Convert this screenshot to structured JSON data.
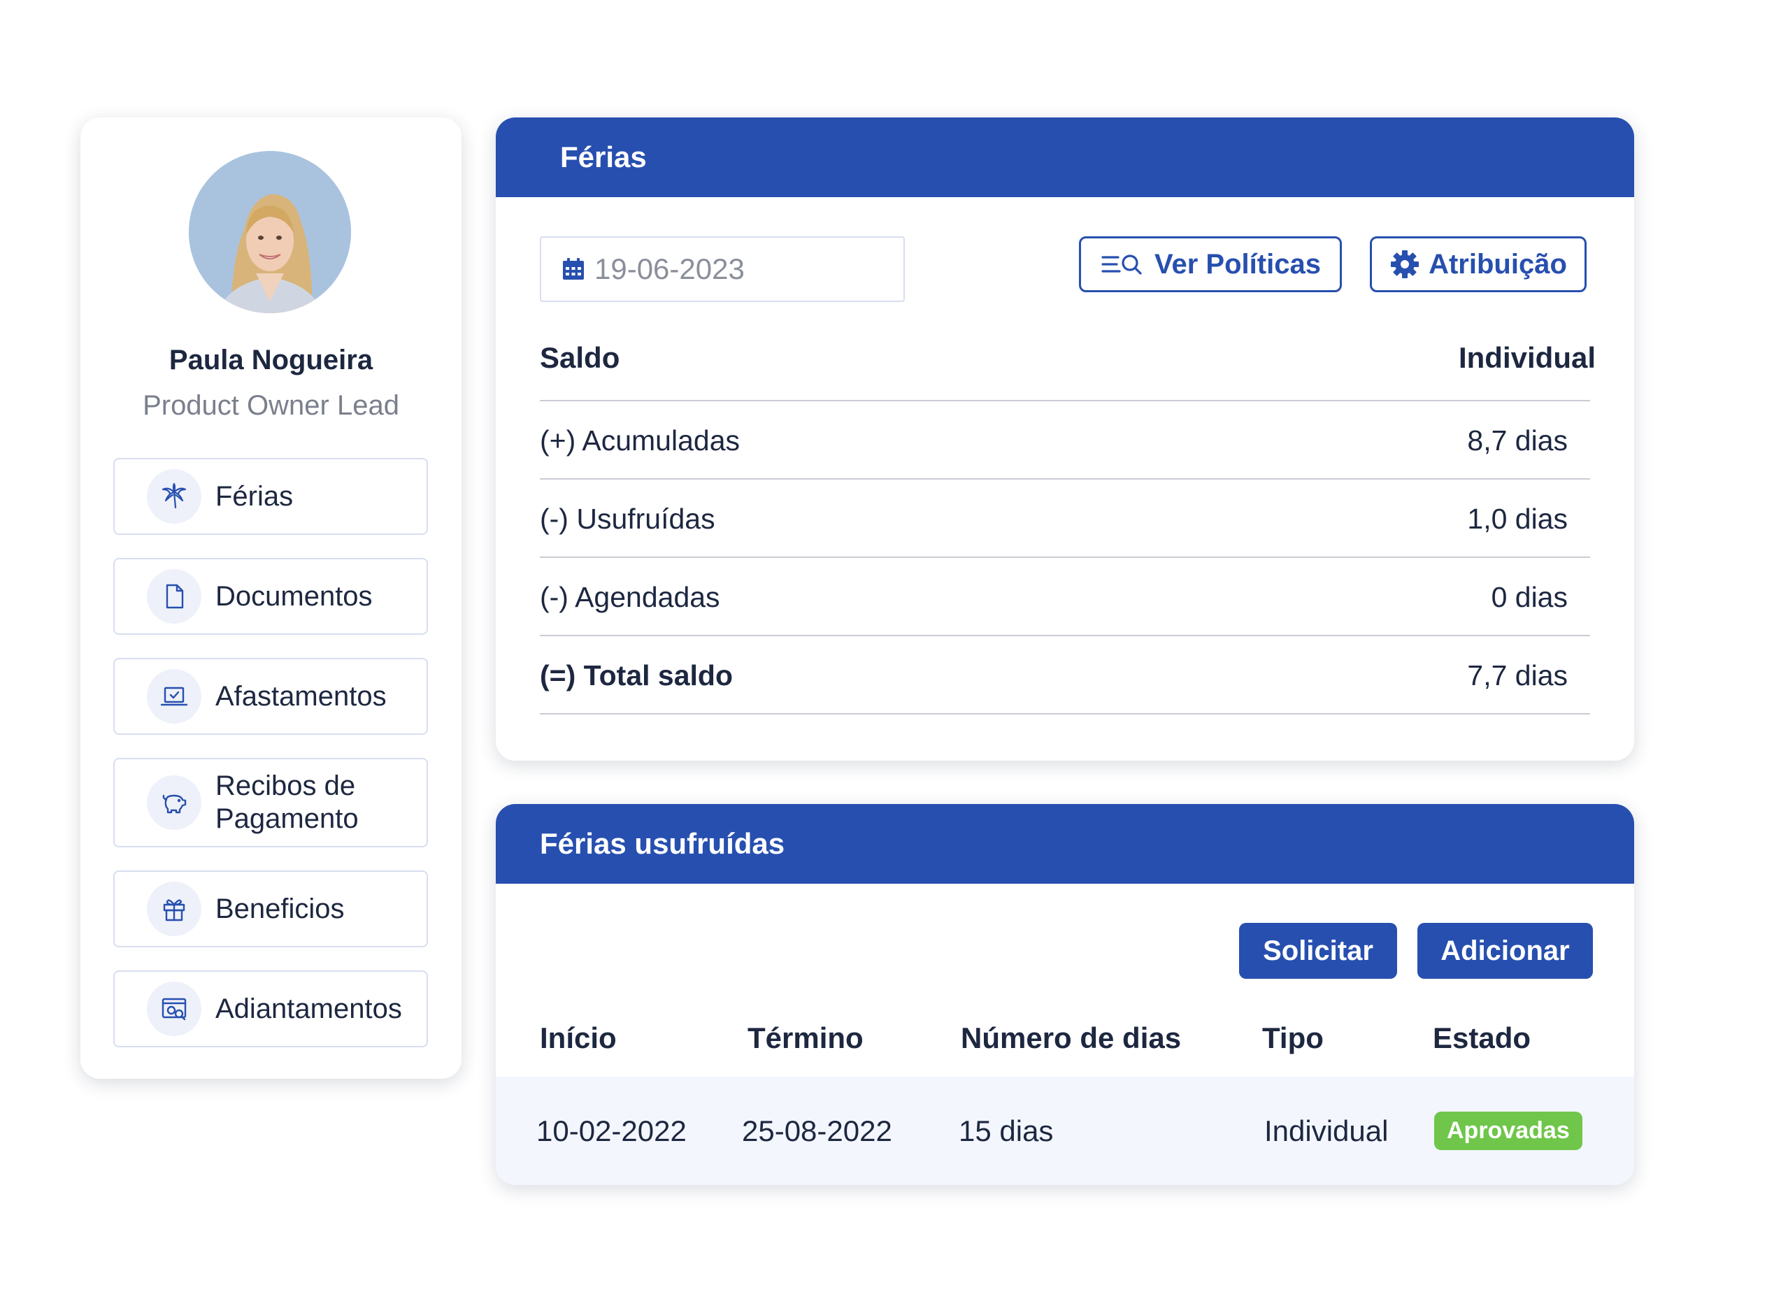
{
  "profile": {
    "name": "Paula Nogueira",
    "role": "Product Owner Lead",
    "menu": [
      {
        "label": "Férias",
        "icon": "palm-tree-icon"
      },
      {
        "label": "Documentos",
        "icon": "document-icon"
      },
      {
        "label": "Afastamentos",
        "icon": "laptop-check-icon"
      },
      {
        "label": "Recibos de Pagamento",
        "icon": "piggy-bank-icon"
      },
      {
        "label": "Beneficios",
        "icon": "gift-icon"
      },
      {
        "label": "Adiantamentos",
        "icon": "payment-window-icon"
      }
    ]
  },
  "vacation": {
    "title": "Férias",
    "date": "19-06-2023",
    "policies_label": "Ver Políticas",
    "assign_label": "Atribuição",
    "balance_header": "Saldo",
    "individual_header": "Individual",
    "rows": [
      {
        "label": "(+) Acumuladas",
        "value": "8,7 dias"
      },
      {
        "label": "(-) Usufruídas",
        "value": "1,0 dias"
      },
      {
        "label": "(-) Agendadas",
        "value": "0 dias"
      },
      {
        "label": "(=) Total saldo",
        "value": "7,7 dias"
      }
    ]
  },
  "used": {
    "title": "Férias usufruídas",
    "request_label": "Solicitar",
    "add_label": "Adicionar",
    "columns": [
      "Início",
      "Término",
      "Número de dias",
      "Tipo",
      "Estado"
    ],
    "rows": [
      {
        "start": "10-02-2022",
        "end": "25-08-2022",
        "days": "15 dias",
        "type": "Individual",
        "status": "Aprovadas"
      }
    ]
  },
  "colors": {
    "primary": "#274faf",
    "approved": "#6fc64a"
  }
}
